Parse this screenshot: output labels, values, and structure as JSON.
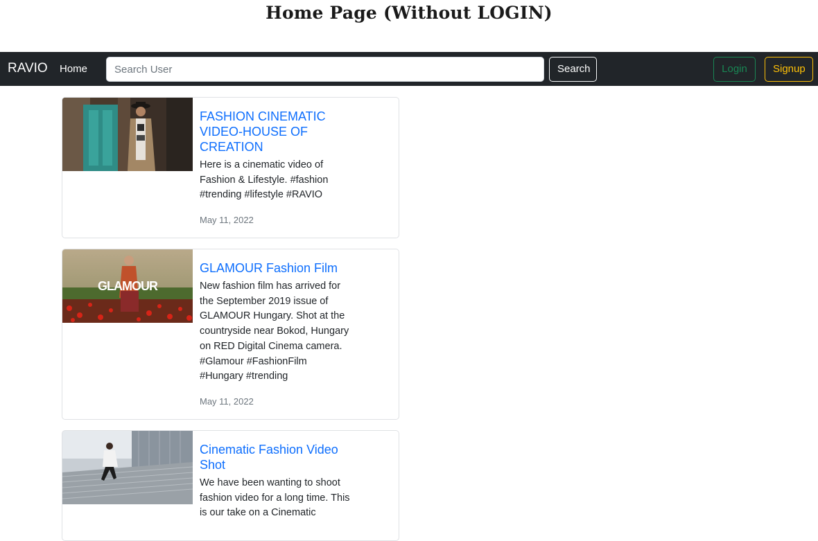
{
  "page_heading": "Home Page (Without LOGIN)",
  "navbar": {
    "brand": "RAVIO",
    "home_link": "Home",
    "search_placeholder": "Search User",
    "search_button": "Search",
    "login_button": "Login",
    "signup_button": "Signup"
  },
  "posts": [
    {
      "title": "FASHION CINEMATIC VIDEO-HOUSE OF CREATION",
      "description": "Here is a cinematic video of Fashion & Lifestyle. #fashion #trending #lifestyle #RAVIO",
      "date": "May 11, 2022"
    },
    {
      "title": "GLAMOUR Fashion Film",
      "thumbnail_text": "GLAMOUR",
      "description": "New fashion film has arrived for the September 2019 issue of GLAMOUR Hungary. Shot at the countryside near Bokod, Hungary on RED Digital Cinema camera. #Glamour #FashionFilm #Hungary #trending",
      "date": "May 11, 2022"
    },
    {
      "title": "Cinematic Fashion Video Shot",
      "description": "We have been wanting to shoot fashion video for a long time. This is our take on a Cinematic"
    }
  ],
  "colors": {
    "navbar_bg": "#212529",
    "link_blue": "#0d6efd",
    "login_green": "#198754",
    "signup_yellow": "#ffc107"
  }
}
